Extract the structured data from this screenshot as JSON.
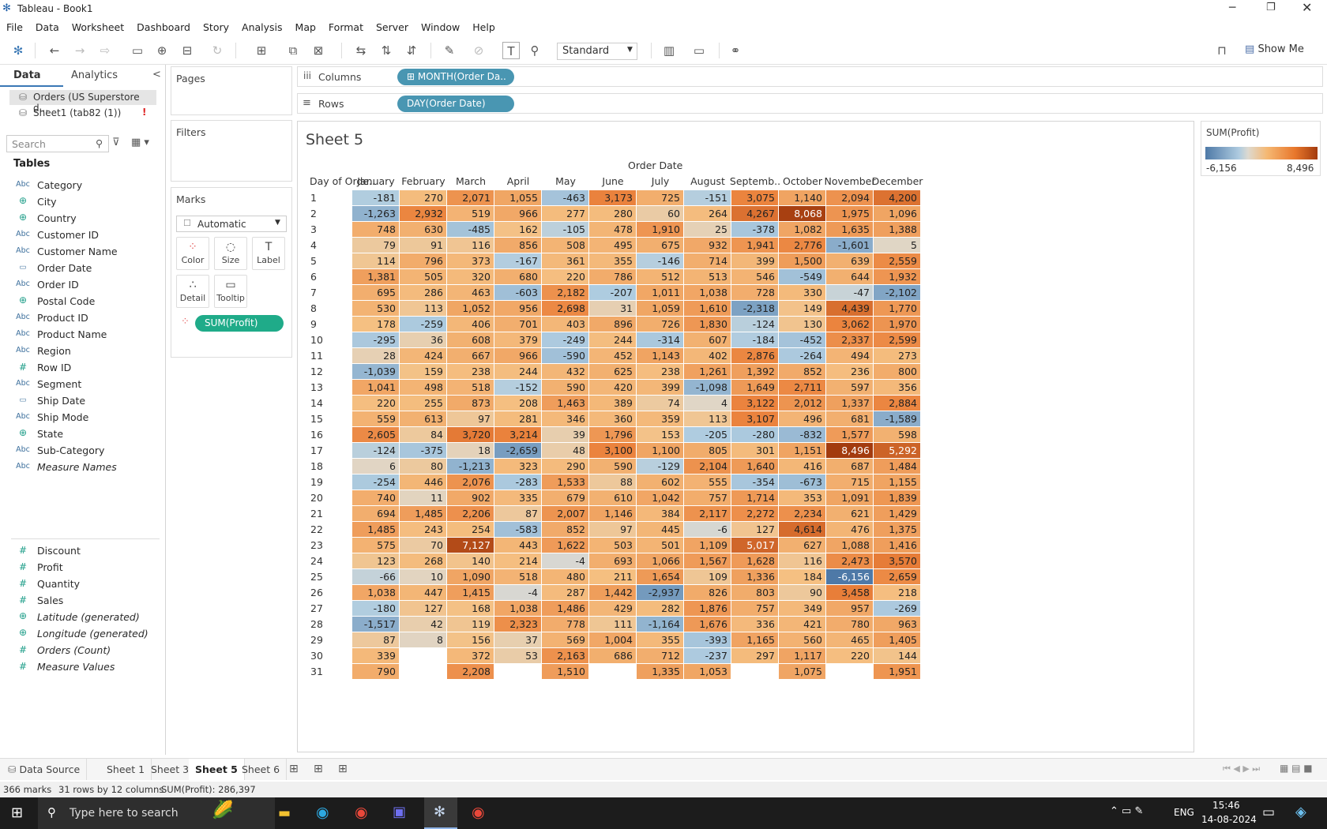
{
  "window": {
    "title": "Tableau - Book1",
    "controls": [
      "minimize",
      "restore",
      "close"
    ]
  },
  "menu": [
    "File",
    "Data",
    "Worksheet",
    "Dashboard",
    "Story",
    "Analysis",
    "Map",
    "Format",
    "Server",
    "Window",
    "Help"
  ],
  "toolbar": {
    "fit": "Standard",
    "show_me": "Show Me"
  },
  "leftpane": {
    "tabs": [
      "Data",
      "Analytics"
    ],
    "datasources": [
      "Orders (US Superstore d...",
      "Sheet1 (tab82 (1))"
    ],
    "search_placeholder": "Search",
    "tables_label": "Tables",
    "dimensions": [
      {
        "type": "Abc",
        "name": "Category"
      },
      {
        "type": "geo",
        "name": "City"
      },
      {
        "type": "geo",
        "name": "Country"
      },
      {
        "type": "Abc",
        "name": "Customer ID"
      },
      {
        "type": "Abc",
        "name": "Customer Name"
      },
      {
        "type": "date",
        "name": "Order Date"
      },
      {
        "type": "Abc",
        "name": "Order ID"
      },
      {
        "type": "geo",
        "name": "Postal Code"
      },
      {
        "type": "Abc",
        "name": "Product ID"
      },
      {
        "type": "Abc",
        "name": "Product Name"
      },
      {
        "type": "Abc",
        "name": "Region"
      },
      {
        "type": "#",
        "name": "Row ID"
      },
      {
        "type": "Abc",
        "name": "Segment"
      },
      {
        "type": "date",
        "name": "Ship Date"
      },
      {
        "type": "Abc",
        "name": "Ship Mode"
      },
      {
        "type": "geo",
        "name": "State"
      },
      {
        "type": "Abc",
        "name": "Sub-Category"
      },
      {
        "type": "Abc",
        "name": "Measure Names",
        "italic": true
      }
    ],
    "measures": [
      {
        "type": "#",
        "name": "Discount"
      },
      {
        "type": "#",
        "name": "Profit"
      },
      {
        "type": "#",
        "name": "Quantity"
      },
      {
        "type": "#",
        "name": "Sales"
      },
      {
        "type": "geo",
        "name": "Latitude (generated)",
        "italic": true
      },
      {
        "type": "geo",
        "name": "Longitude (generated)",
        "italic": true
      },
      {
        "type": "#",
        "name": "Orders (Count)",
        "italic": true
      },
      {
        "type": "#",
        "name": "Measure Values",
        "italic": true
      }
    ]
  },
  "cards": {
    "pages": "Pages",
    "filters": "Filters",
    "marks": "Marks",
    "mark_type": "Automatic",
    "mark_buttons": [
      "Color",
      "Size",
      "Label",
      "Detail",
      "Tooltip"
    ],
    "mark_pill": "SUM(Profit)"
  },
  "shelves": {
    "columns_label": "Columns",
    "columns_pill": "MONTH(Order Da..",
    "rows_label": "Rows",
    "rows_pill": "DAY(Order Date)"
  },
  "sheet": {
    "title": "Sheet 5",
    "col_group": "Order Date",
    "row_header": "Day of Orde.."
  },
  "legend": {
    "title": "SUM(Profit)",
    "min": "-6,156",
    "max": "8,496",
    "min_value": -6156,
    "max_value": 8496
  },
  "chart_data": {
    "type": "heatmap",
    "x": [
      "January",
      "February",
      "March",
      "April",
      "May",
      "June",
      "July",
      "August",
      "Septemb..",
      "October",
      "November",
      "December"
    ],
    "y": [
      1,
      2,
      3,
      4,
      5,
      6,
      7,
      8,
      9,
      10,
      11,
      12,
      13,
      14,
      15,
      16,
      17,
      18,
      19,
      20,
      21,
      22,
      23,
      24,
      25,
      26,
      27,
      28,
      29,
      30,
      31
    ],
    "values": [
      [
        -181,
        270,
        2071,
        1055,
        -463,
        3173,
        725,
        -151,
        3075,
        1140,
        2094,
        4200
      ],
      [
        -1263,
        2932,
        519,
        966,
        277,
        280,
        60,
        264,
        4267,
        8068,
        1975,
        1096
      ],
      [
        748,
        630,
        -485,
        162,
        -105,
        478,
        1910,
        25,
        -378,
        1082,
        1635,
        1388
      ],
      [
        79,
        91,
        116,
        856,
        508,
        495,
        675,
        932,
        1941,
        2776,
        -1601,
        5
      ],
      [
        114,
        796,
        373,
        -167,
        361,
        355,
        -146,
        714,
        399,
        1500,
        639,
        2559
      ],
      [
        1381,
        505,
        320,
        680,
        220,
        786,
        512,
        513,
        546,
        -549,
        644,
        1932
      ],
      [
        695,
        286,
        463,
        -603,
        2182,
        -207,
        1011,
        1038,
        728,
        330,
        -47,
        -2102
      ],
      [
        530,
        113,
        1052,
        956,
        2698,
        31,
        1059,
        1610,
        -2318,
        149,
        4439,
        1770
      ],
      [
        178,
        -259,
        406,
        701,
        403,
        896,
        726,
        1830,
        -124,
        130,
        3062,
        1970
      ],
      [
        -295,
        36,
        608,
        379,
        -249,
        244,
        -314,
        607,
        -184,
        -452,
        2337,
        2599
      ],
      [
        28,
        424,
        667,
        966,
        -590,
        452,
        1143,
        402,
        2876,
        -264,
        494,
        273
      ],
      [
        -1039,
        159,
        238,
        244,
        432,
        625,
        238,
        1261,
        1392,
        852,
        236,
        800
      ],
      [
        1041,
        498,
        518,
        -152,
        590,
        420,
        399,
        -1098,
        1649,
        2711,
        597,
        356
      ],
      [
        220,
        255,
        873,
        208,
        1463,
        389,
        74,
        4,
        3122,
        2012,
        1337,
        2884
      ],
      [
        559,
        613,
        97,
        281,
        346,
        360,
        359,
        113,
        3107,
        496,
        681,
        -1589
      ],
      [
        2605,
        84,
        3720,
        3214,
        39,
        1796,
        153,
        -205,
        -280,
        -832,
        1577,
        598
      ],
      [
        -124,
        -375,
        18,
        -2659,
        48,
        3100,
        1100,
        805,
        301,
        1151,
        8496,
        5292
      ],
      [
        6,
        80,
        -1213,
        323,
        290,
        590,
        -129,
        2104,
        1640,
        416,
        687,
        1484
      ],
      [
        -254,
        446,
        2076,
        -283,
        1533,
        88,
        602,
        555,
        -354,
        -673,
        715,
        1155
      ],
      [
        740,
        11,
        902,
        335,
        679,
        610,
        1042,
        757,
        1714,
        353,
        1091,
        1839
      ],
      [
        694,
        1485,
        2206,
        87,
        2007,
        1146,
        384,
        2117,
        2272,
        2234,
        621,
        1429
      ],
      [
        1485,
        243,
        254,
        -583,
        852,
        97,
        445,
        -6,
        127,
        4614,
        476,
        1375
      ],
      [
        575,
        70,
        7127,
        443,
        1622,
        503,
        501,
        1109,
        5017,
        627,
        1088,
        1416
      ],
      [
        123,
        268,
        140,
        214,
        -4,
        693,
        1066,
        1567,
        1628,
        116,
        2473,
        3570
      ],
      [
        -66,
        10,
        1090,
        518,
        480,
        211,
        1654,
        109,
        1336,
        184,
        -6156,
        2659
      ],
      [
        1038,
        447,
        1415,
        -4,
        287,
        1442,
        -2937,
        826,
        803,
        90,
        3458,
        218
      ],
      [
        -180,
        127,
        168,
        1038,
        1486,
        429,
        282,
        1876,
        757,
        349,
        957,
        -269
      ],
      [
        -1517,
        42,
        119,
        2323,
        778,
        111,
        -1164,
        1676,
        336,
        421,
        780,
        963
      ],
      [
        87,
        8,
        156,
        37,
        569,
        1004,
        355,
        -393,
        1165,
        560,
        465,
        1405
      ],
      [
        339,
        null,
        372,
        53,
        2163,
        686,
        712,
        -237,
        297,
        1117,
        220,
        144
      ],
      [
        790,
        null,
        2208,
        null,
        1510,
        null,
        1335,
        1053,
        null,
        1075,
        null,
        1951
      ]
    ]
  },
  "tabs": [
    "Data Source",
    "Sheet 1",
    "Sheet 3",
    "Sheet 5",
    "Sheet 6"
  ],
  "active_tab": "Sheet 5",
  "status": {
    "marks": "366 marks",
    "dims": "31 rows by 12 columns",
    "sum": "SUM(Profit): 286,397"
  },
  "taskbar": {
    "search": "Type here to search",
    "lang": "ENG",
    "time": "15:46",
    "date": "14-08-2024"
  }
}
